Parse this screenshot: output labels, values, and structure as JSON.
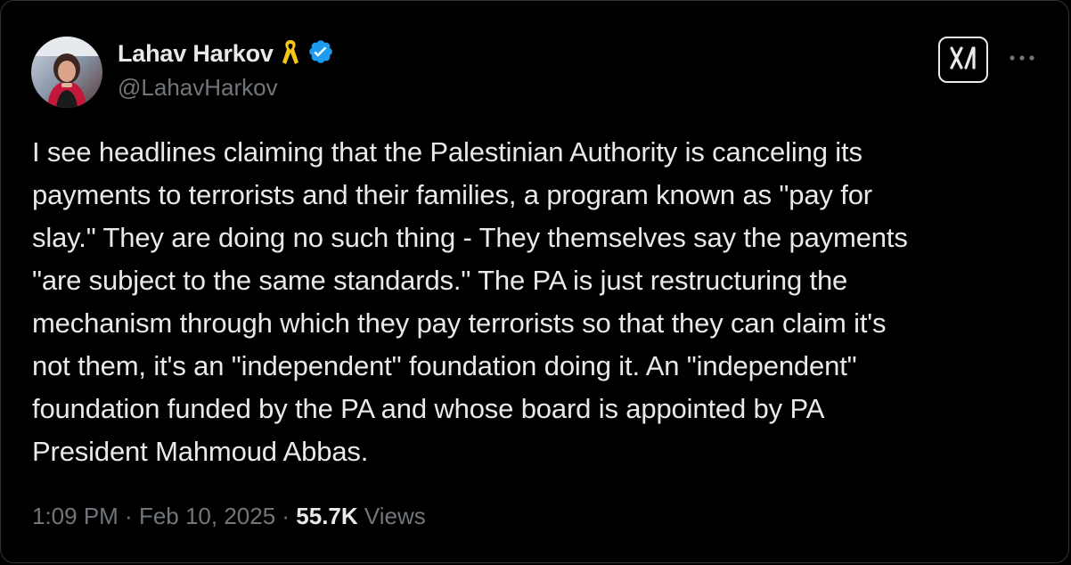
{
  "author": {
    "display_name": "Lahav Harkov",
    "handle": "@LahavHarkov",
    "badges": [
      "yellow-ribbon-icon",
      "verified-badge-icon"
    ],
    "verified_color": "#1d9bf0",
    "ribbon_color": "#f5c518"
  },
  "actions": {
    "grok_icon": "grok-icon",
    "more_icon": "more-dots-icon"
  },
  "tweet": {
    "lines": [
      "I see headlines claiming that the Palestinian Authority is canceling its",
      "payments to terrorists and their families, a program known as \"pay for",
      "slay.\" They are doing no such thing - They themselves say the payments",
      "\"are subject to the same standards.\" The PA is just restructuring the",
      "mechanism through which they pay terrorists so that they can claim it's",
      "not them, it's an \"independent\" foundation doing it. An \"independent\"",
      "foundation funded by the PA and whose board is appointed by PA",
      "President Mahmoud Abbas."
    ]
  },
  "meta": {
    "time": "1:09 PM",
    "separator": " · ",
    "date": "Feb 10, 2025",
    "views_count": "55.7K",
    "views_label": " Views"
  },
  "colors": {
    "background": "#000000",
    "text": "#e7e9ea",
    "muted": "#71767b"
  }
}
